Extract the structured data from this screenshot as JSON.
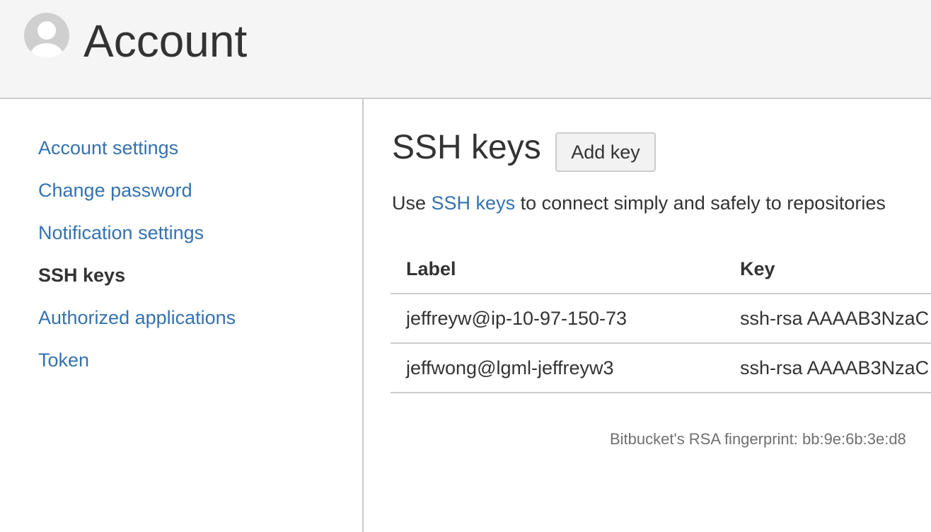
{
  "header": {
    "title": "Account",
    "avatar_icon": "user-avatar-icon"
  },
  "sidebar": {
    "items": [
      {
        "label": "Account settings",
        "active": false
      },
      {
        "label": "Change password",
        "active": false
      },
      {
        "label": "Notification settings",
        "active": false
      },
      {
        "label": "SSH keys",
        "active": true
      },
      {
        "label": "Authorized applications",
        "active": false
      },
      {
        "label": "Token",
        "active": false
      }
    ]
  },
  "main": {
    "title": "SSH keys",
    "add_key_label": "Add key",
    "intro": {
      "prefix": "Use ",
      "link_text": "SSH keys",
      "suffix": " to connect simply and safely to repositories"
    },
    "table": {
      "headers": {
        "label": "Label",
        "key": "Key"
      },
      "rows": [
        {
          "label": "jeffreyw@ip-10-97-150-73",
          "key": "ssh-rsa AAAAB3NzaC"
        },
        {
          "label": "jeffwong@lgml-jeffreyw3",
          "key": "ssh-rsa AAAAB3NzaC"
        }
      ]
    },
    "fingerprint": "Bitbucket's RSA fingerprint: bb:9e:6b:3e:d8"
  },
  "colors": {
    "link": "#3572b0",
    "text": "#333333",
    "header_bg": "#f5f5f5",
    "border": "#cccccc",
    "muted": "#707070"
  }
}
